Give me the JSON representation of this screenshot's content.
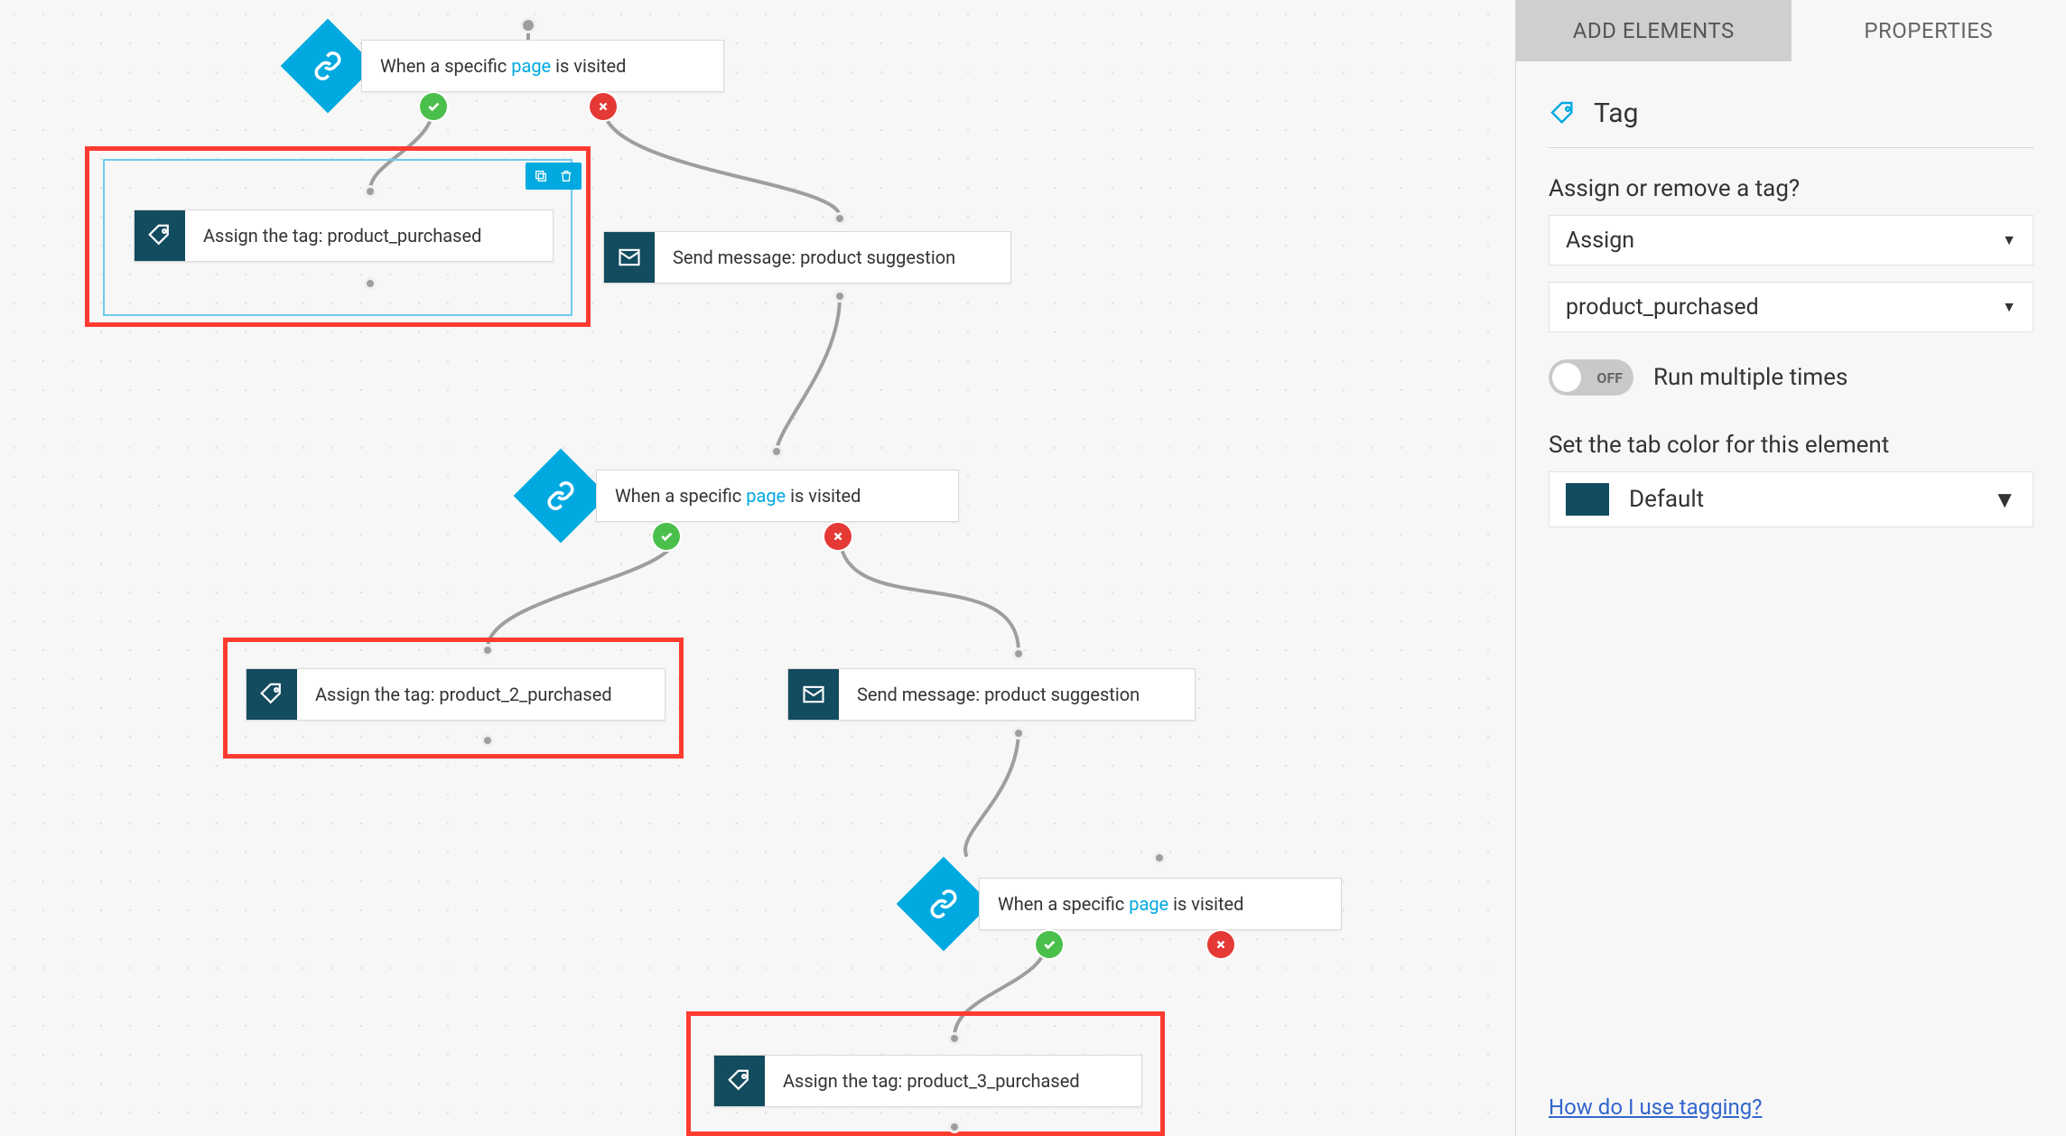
{
  "canvas": {
    "triggers": [
      {
        "prefix": "When a specific ",
        "link": "page",
        "suffix": " is visited"
      },
      {
        "prefix": "When a specific ",
        "link": "page",
        "suffix": " is visited"
      },
      {
        "prefix": "When a specific ",
        "link": "page",
        "suffix": " is visited"
      }
    ],
    "tag_nodes": [
      {
        "label": "Assign the tag: product_purchased"
      },
      {
        "label": "Assign the tag: product_2_purchased"
      },
      {
        "label": "Assign the tag: product_3_purchased"
      }
    ],
    "message_nodes": [
      {
        "label": "Send message: product suggestion"
      },
      {
        "label": "Send message: product suggestion"
      }
    ]
  },
  "panel": {
    "tabs": {
      "add": "ADD ELEMENTS",
      "properties": "PROPERTIES"
    },
    "title": "Tag",
    "assign_label": "Assign or remove a tag?",
    "assign_value": "Assign",
    "tag_value": "product_purchased",
    "toggle_text": "OFF",
    "toggle_label": "Run multiple times",
    "color_label": "Set the tab color for this element",
    "color_value": "Default",
    "help_link": "How do I use tagging?"
  }
}
